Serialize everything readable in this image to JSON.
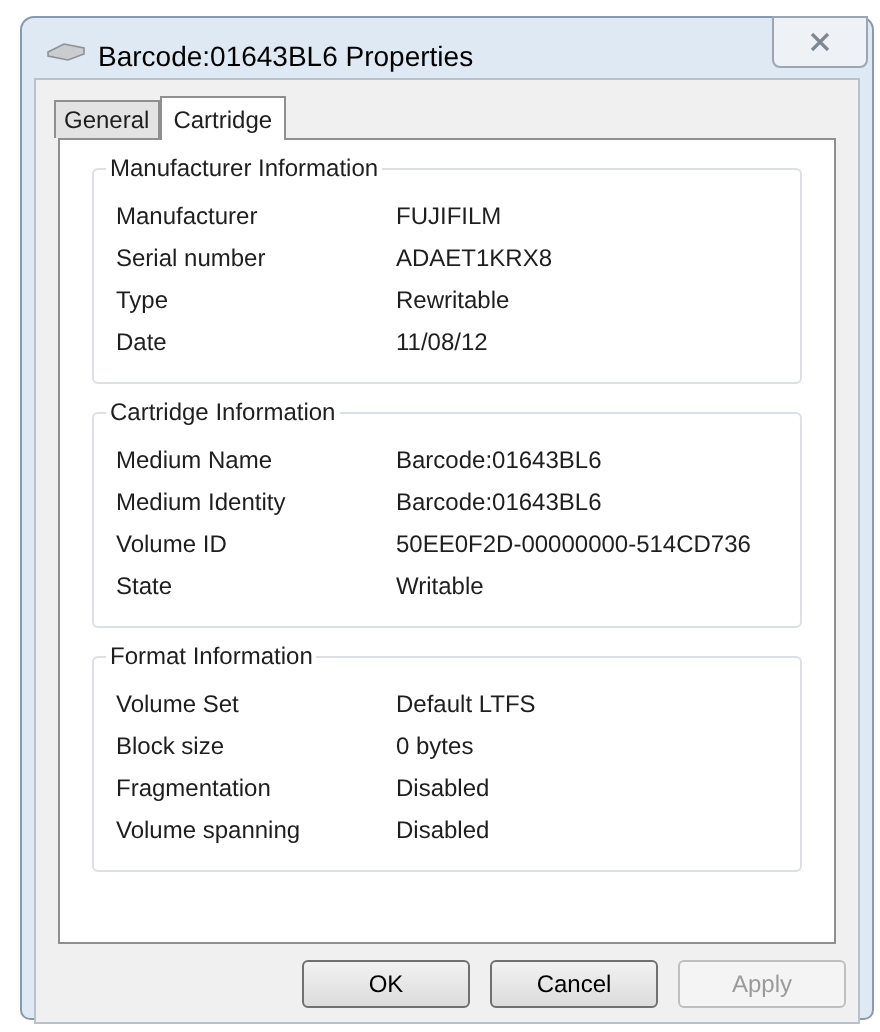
{
  "window": {
    "title": "Barcode:01643BL6 Properties"
  },
  "tabs": [
    {
      "label": "General",
      "selected": false
    },
    {
      "label": "Cartridge",
      "selected": true
    }
  ],
  "groups": [
    {
      "title": "Manufacturer Information",
      "rows": [
        {
          "label": "Manufacturer",
          "value": "FUJIFILM"
        },
        {
          "label": "Serial number",
          "value": "ADAET1KRX8"
        },
        {
          "label": "Type",
          "value": "Rewritable"
        },
        {
          "label": "Date",
          "value": "11/08/12"
        }
      ]
    },
    {
      "title": "Cartridge Information",
      "rows": [
        {
          "label": "Medium Name",
          "value": "Barcode:01643BL6"
        },
        {
          "label": "Medium Identity",
          "value": "Barcode:01643BL6"
        },
        {
          "label": "Volume ID",
          "value": "50EE0F2D-00000000-514CD736"
        },
        {
          "label": "State",
          "value": "Writable"
        }
      ]
    },
    {
      "title": "Format Information",
      "rows": [
        {
          "label": "Volume Set",
          "value": "Default LTFS"
        },
        {
          "label": "Block size",
          "value": "0 bytes"
        },
        {
          "label": "Fragmentation",
          "value": "Disabled"
        },
        {
          "label": "Volume spanning",
          "value": "Disabled"
        }
      ]
    }
  ],
  "buttons": [
    {
      "label": "OK",
      "disabled": false
    },
    {
      "label": "Cancel",
      "disabled": false
    },
    {
      "label": "Apply",
      "disabled": true
    }
  ]
}
